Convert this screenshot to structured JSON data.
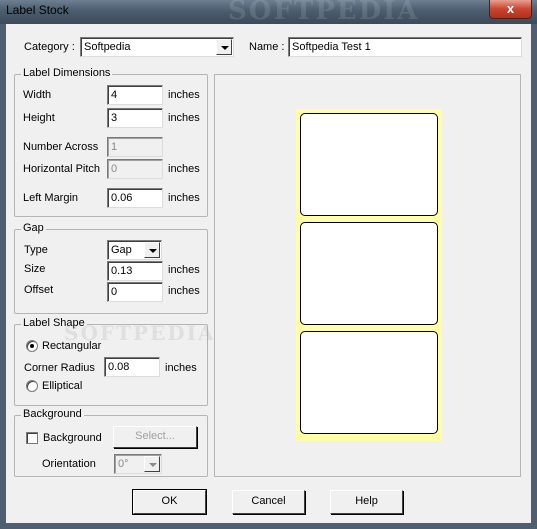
{
  "window": {
    "title": "Label Stock",
    "close_glyph": "x",
    "watermark": "SOFTPEDIA"
  },
  "top": {
    "category_label": "Category :",
    "category_value": "Softpedia",
    "name_label": "Name :",
    "name_value": "Softpedia Test 1"
  },
  "label_dimensions": {
    "title": "Label Dimensions",
    "width_label": "Width",
    "width_value": "4",
    "width_unit": "inches",
    "height_label": "Height",
    "height_value": "3",
    "height_unit": "inches",
    "across_label": "Number Across",
    "across_value": "1",
    "hpitch_label": "Horizontal Pitch",
    "hpitch_value": "0",
    "hpitch_unit": "inches",
    "left_margin_label": "Left Margin",
    "left_margin_value": "0.06",
    "left_margin_unit": "inches"
  },
  "gap": {
    "title": "Gap",
    "type_label": "Type",
    "type_value": "Gap",
    "size_label": "Size",
    "size_value": "0.13",
    "size_unit": "inches",
    "offset_label": "Offset",
    "offset_value": "0",
    "offset_unit": "inches"
  },
  "label_shape": {
    "title": "Label Shape",
    "rect_label": "Rectangular",
    "rect_checked": true,
    "corner_label": "Corner Radius",
    "corner_value": "0.08",
    "corner_unit": "inches",
    "elliptical_label": "Elliptical",
    "elliptical_checked": false,
    "watermark": "SOFTPEDIA"
  },
  "background": {
    "title": "Background",
    "checkbox_label": "Background",
    "checked": false,
    "select_button": "Select...",
    "orientation_label": "Orientation",
    "orientation_value": "0°"
  },
  "preview": {
    "label_count": 3,
    "sheet_color": "#ffffa8"
  },
  "buttons": {
    "ok": "OK",
    "cancel": "Cancel",
    "help": "Help"
  }
}
